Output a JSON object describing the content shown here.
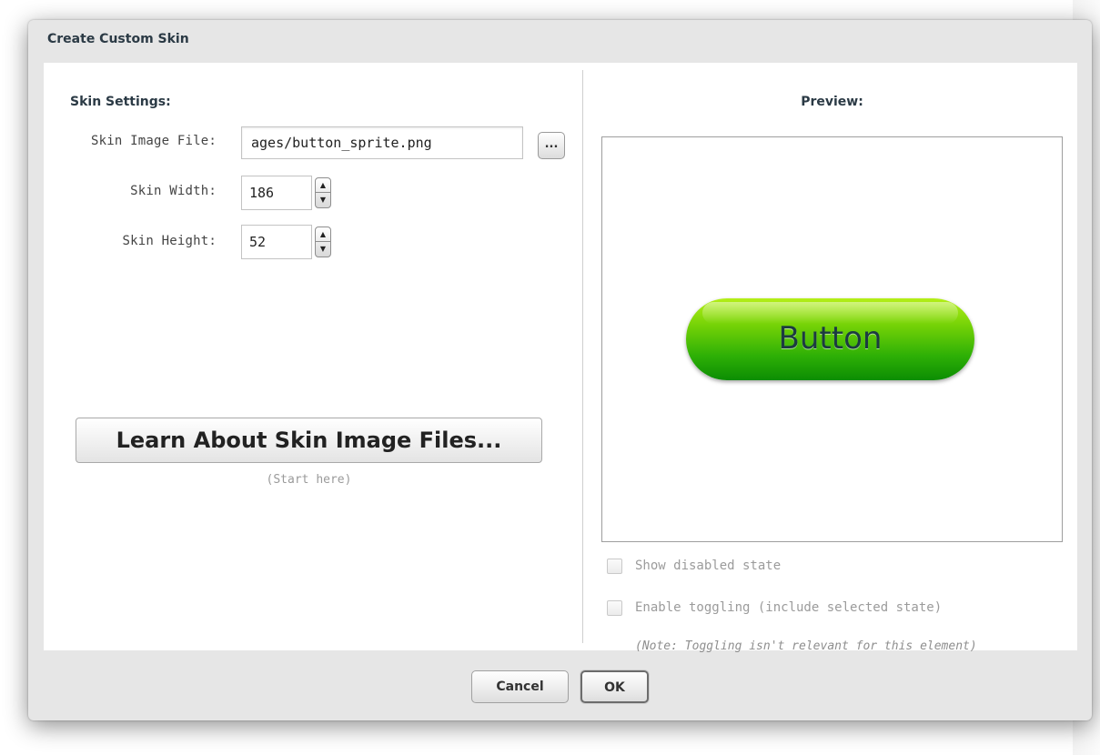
{
  "dialog": {
    "title": "Create Custom Skin"
  },
  "settings": {
    "section_title": "Skin Settings:",
    "image_file": {
      "label": "Skin Image File:",
      "value": "ages/button_sprite.png",
      "browse_label": "..."
    },
    "width": {
      "label": "Skin Width:",
      "value": "186"
    },
    "height": {
      "label": "Skin Height:",
      "value": "52"
    },
    "learn_button": "Learn About Skin Image Files...",
    "learn_hint": "(Start here)"
  },
  "preview": {
    "title": "Preview:",
    "button_text": "Button",
    "button_color": "#2eb006"
  },
  "options": {
    "show_disabled": {
      "label": "Show disabled state",
      "checked": false
    },
    "enable_toggling": {
      "label": "Enable toggling (include selected state)",
      "checked": false
    },
    "note": "(Note: Toggling isn't relevant for this element)"
  },
  "footer": {
    "cancel_label": "Cancel",
    "ok_label": "OK"
  }
}
